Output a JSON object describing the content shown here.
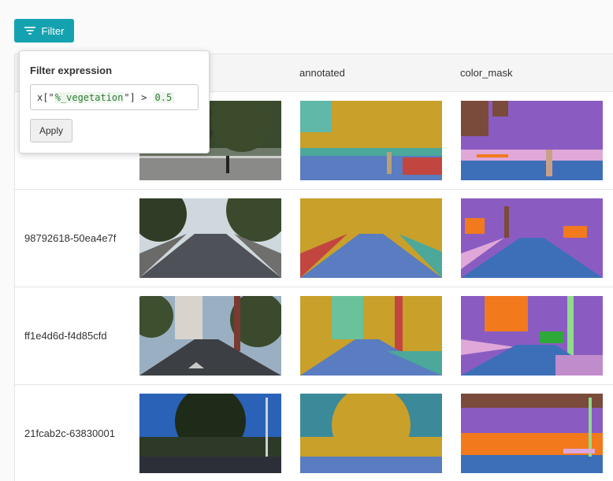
{
  "toolbar": {
    "filter_label": "Filter",
    "icon": "filter-icon"
  },
  "popover": {
    "title": "Filter expression",
    "expr_prefix": "x[\"",
    "expr_key": "%_vegetation",
    "expr_op": "\"] > ",
    "expr_value": "0.5",
    "apply_label": "Apply"
  },
  "table": {
    "columns": [
      "",
      "",
      "annotated",
      "color_mask"
    ],
    "rows": [
      {
        "id": ""
      },
      {
        "id": "98792618-50ea4e7f"
      },
      {
        "id": "ff1e4d6d-f4d85cfd"
      },
      {
        "id": "21fcab2c-63830001"
      }
    ]
  },
  "colors": {
    "accent": "#15a2b0",
    "mask_vegetation": "#c8a02a",
    "mask_road": "#3d6fb8",
    "mask_sky": "#8a5cc2",
    "mask_building": "#f27a1c",
    "mask_tree_brown": "#7a4a3a",
    "mask_green": "#2fa83a"
  }
}
